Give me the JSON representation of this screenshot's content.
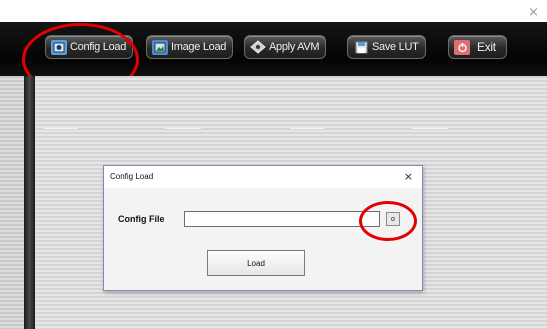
{
  "window": {
    "close_glyph": "×"
  },
  "toolbar": {
    "buttons": [
      {
        "label": "Config Load",
        "icon": "config-load-icon"
      },
      {
        "label": "Image Load",
        "icon": "image-load-icon"
      },
      {
        "label": "Apply AVM",
        "icon": "apply-avm-icon"
      },
      {
        "label": "Save LUT",
        "icon": "save-icon"
      },
      {
        "label": "Exit",
        "icon": "power-icon"
      }
    ]
  },
  "dialog": {
    "title": "Config Load",
    "close_glyph": "×",
    "config_file_label": "Config File",
    "config_file_value": "",
    "browse_label": "o",
    "load_label": "Load"
  },
  "colors": {
    "annotation": "#e30000",
    "toolbar_bg": "#040404",
    "dialog_border": "#7f8cae"
  }
}
